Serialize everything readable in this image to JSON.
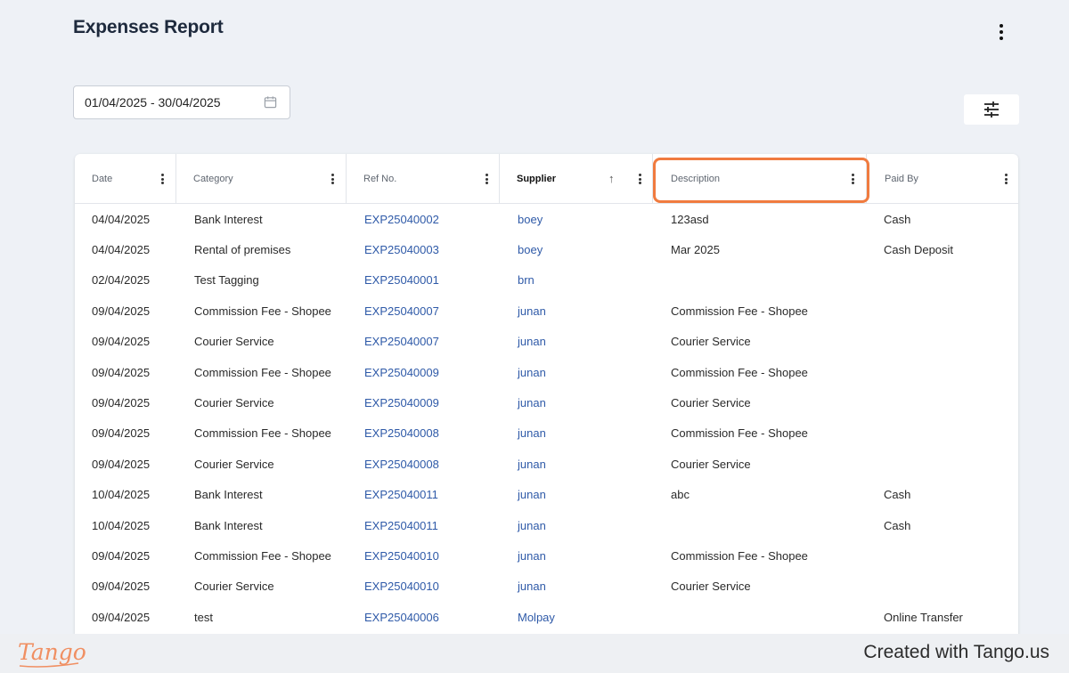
{
  "header": {
    "title": "Expenses Report"
  },
  "filters": {
    "date_range": "01/04/2025 - 30/04/2025"
  },
  "table": {
    "columns": [
      {
        "key": "date",
        "label": "Date"
      },
      {
        "key": "category",
        "label": "Category"
      },
      {
        "key": "ref",
        "label": "Ref No."
      },
      {
        "key": "supplier",
        "label": "Supplier",
        "sorted": "ascending"
      },
      {
        "key": "description",
        "label": "Description"
      },
      {
        "key": "paid_by",
        "label": "Paid By"
      }
    ],
    "rows": [
      {
        "date": "04/04/2025",
        "category": "Bank Interest",
        "ref": "EXP25040002",
        "supplier": "boey",
        "description": "123asd",
        "paid_by": "Cash"
      },
      {
        "date": "04/04/2025",
        "category": "Rental of premises",
        "ref": "EXP25040003",
        "supplier": "boey",
        "description": "Mar 2025",
        "paid_by": "Cash Deposit"
      },
      {
        "date": "02/04/2025",
        "category": "Test Tagging",
        "ref": "EXP25040001",
        "supplier": "brn",
        "description": "",
        "paid_by": ""
      },
      {
        "date": "09/04/2025",
        "category": "Commission Fee - Shopee",
        "ref": "EXP25040007",
        "supplier": "junan",
        "description": "Commission Fee - Shopee",
        "paid_by": ""
      },
      {
        "date": "09/04/2025",
        "category": "Courier Service",
        "ref": "EXP25040007",
        "supplier": "junan",
        "description": "Courier Service",
        "paid_by": ""
      },
      {
        "date": "09/04/2025",
        "category": "Commission Fee - Shopee",
        "ref": "EXP25040009",
        "supplier": "junan",
        "description": "Commission Fee - Shopee",
        "paid_by": ""
      },
      {
        "date": "09/04/2025",
        "category": "Courier Service",
        "ref": "EXP25040009",
        "supplier": "junan",
        "description": "Courier Service",
        "paid_by": ""
      },
      {
        "date": "09/04/2025",
        "category": "Commission Fee - Shopee",
        "ref": "EXP25040008",
        "supplier": "junan",
        "description": "Commission Fee - Shopee",
        "paid_by": ""
      },
      {
        "date": "09/04/2025",
        "category": "Courier Service",
        "ref": "EXP25040008",
        "supplier": "junan",
        "description": "Courier Service",
        "paid_by": ""
      },
      {
        "date": "10/04/2025",
        "category": "Bank Interest",
        "ref": "EXP25040011",
        "supplier": "junan",
        "description": "abc",
        "paid_by": "Cash"
      },
      {
        "date": "10/04/2025",
        "category": "Bank Interest",
        "ref": "EXP25040011",
        "supplier": "junan",
        "description": "",
        "paid_by": "Cash"
      },
      {
        "date": "09/04/2025",
        "category": "Commission Fee - Shopee",
        "ref": "EXP25040010",
        "supplier": "junan",
        "description": "Commission Fee - Shopee",
        "paid_by": ""
      },
      {
        "date": "09/04/2025",
        "category": "Courier Service",
        "ref": "EXP25040010",
        "supplier": "junan",
        "description": "Courier Service",
        "paid_by": ""
      },
      {
        "date": "09/04/2025",
        "category": "test",
        "ref": "EXP25040006",
        "supplier": "Molpay",
        "description": "",
        "paid_by": "Online Transfer"
      }
    ]
  },
  "footer": {
    "logo": "Tango",
    "created": "Created with Tango.us"
  },
  "colors": {
    "link": "#2f5aa8",
    "highlight": "#f07b3f",
    "brand": "#f08f62"
  },
  "icons": {
    "more": "more-vertical-icon",
    "calendar": "calendar-icon",
    "filter": "sliders-icon",
    "sort": "arrow-up-icon"
  }
}
